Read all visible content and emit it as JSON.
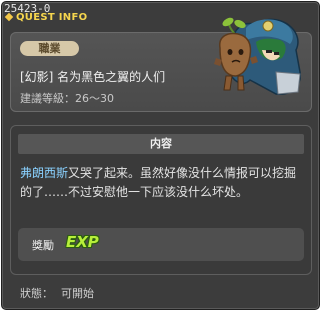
{
  "window": {
    "id_label": "25423-0",
    "title": "QUEST INFO"
  },
  "quest": {
    "job_badge": "職業",
    "name": "[幻影] 名为黑色之翼的人们",
    "level_label": "建議等級：",
    "level_range": "26～30"
  },
  "content": {
    "header": "内容",
    "desc_highlight": "弗朗西斯",
    "desc_text": "又哭了起来。虽然好像没什么情报可以挖掘的了……不过安慰他一下应该没什么坏处。"
  },
  "reward": {
    "label": "獎勵",
    "icon_text": "EXP"
  },
  "status": {
    "label": "狀態：",
    "value": "可開始"
  },
  "colors": {
    "title": "#f6d64e",
    "highlight_name": "#8ad1ff",
    "exp_green": "#b7ef3a",
    "badge_bg": "#d6c8a8"
  }
}
